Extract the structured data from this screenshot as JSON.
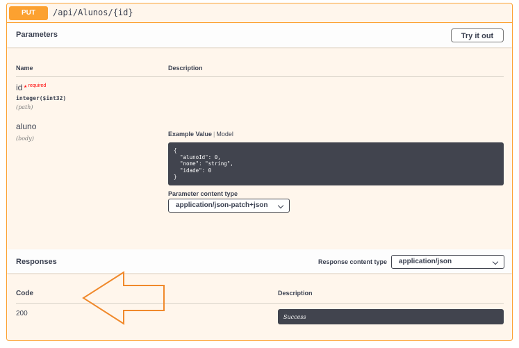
{
  "operation": {
    "method": "PUT",
    "path": "/api/Alunos/{id}"
  },
  "parameters": {
    "title": "Parameters",
    "try_button": "Try it out",
    "columns": {
      "name": "Name",
      "description": "Description"
    },
    "items": [
      {
        "name": "id",
        "required_star": "*",
        "required_text": "required",
        "type": "integer($int32)",
        "in": "(path)"
      },
      {
        "name": "aluno",
        "in": "(body)",
        "tabs": {
          "example": "Example Value",
          "separator": "|",
          "model": "Model"
        },
        "example_lines": [
          "{",
          "  \"alunoId\": 0,",
          "  \"nome\": \"string\",",
          "  \"idade\": 0",
          "}"
        ],
        "content_type_label": "Parameter content type",
        "content_type_value": "application/json-patch+json"
      }
    ]
  },
  "responses": {
    "title": "Responses",
    "content_type_label": "Response content type",
    "content_type_value": "application/json",
    "columns": {
      "code": "Code",
      "description": "Description"
    },
    "rows": [
      {
        "code": "200",
        "description": "Success"
      }
    ]
  },
  "colors": {
    "put_accent": "#fca130",
    "annotation_arrow": "#f0892b",
    "code_bg": "#41444e",
    "required": "#ff0000"
  },
  "icons": {
    "select_chevron": "chevron-down-icon",
    "annotation": "arrow-left-icon"
  }
}
